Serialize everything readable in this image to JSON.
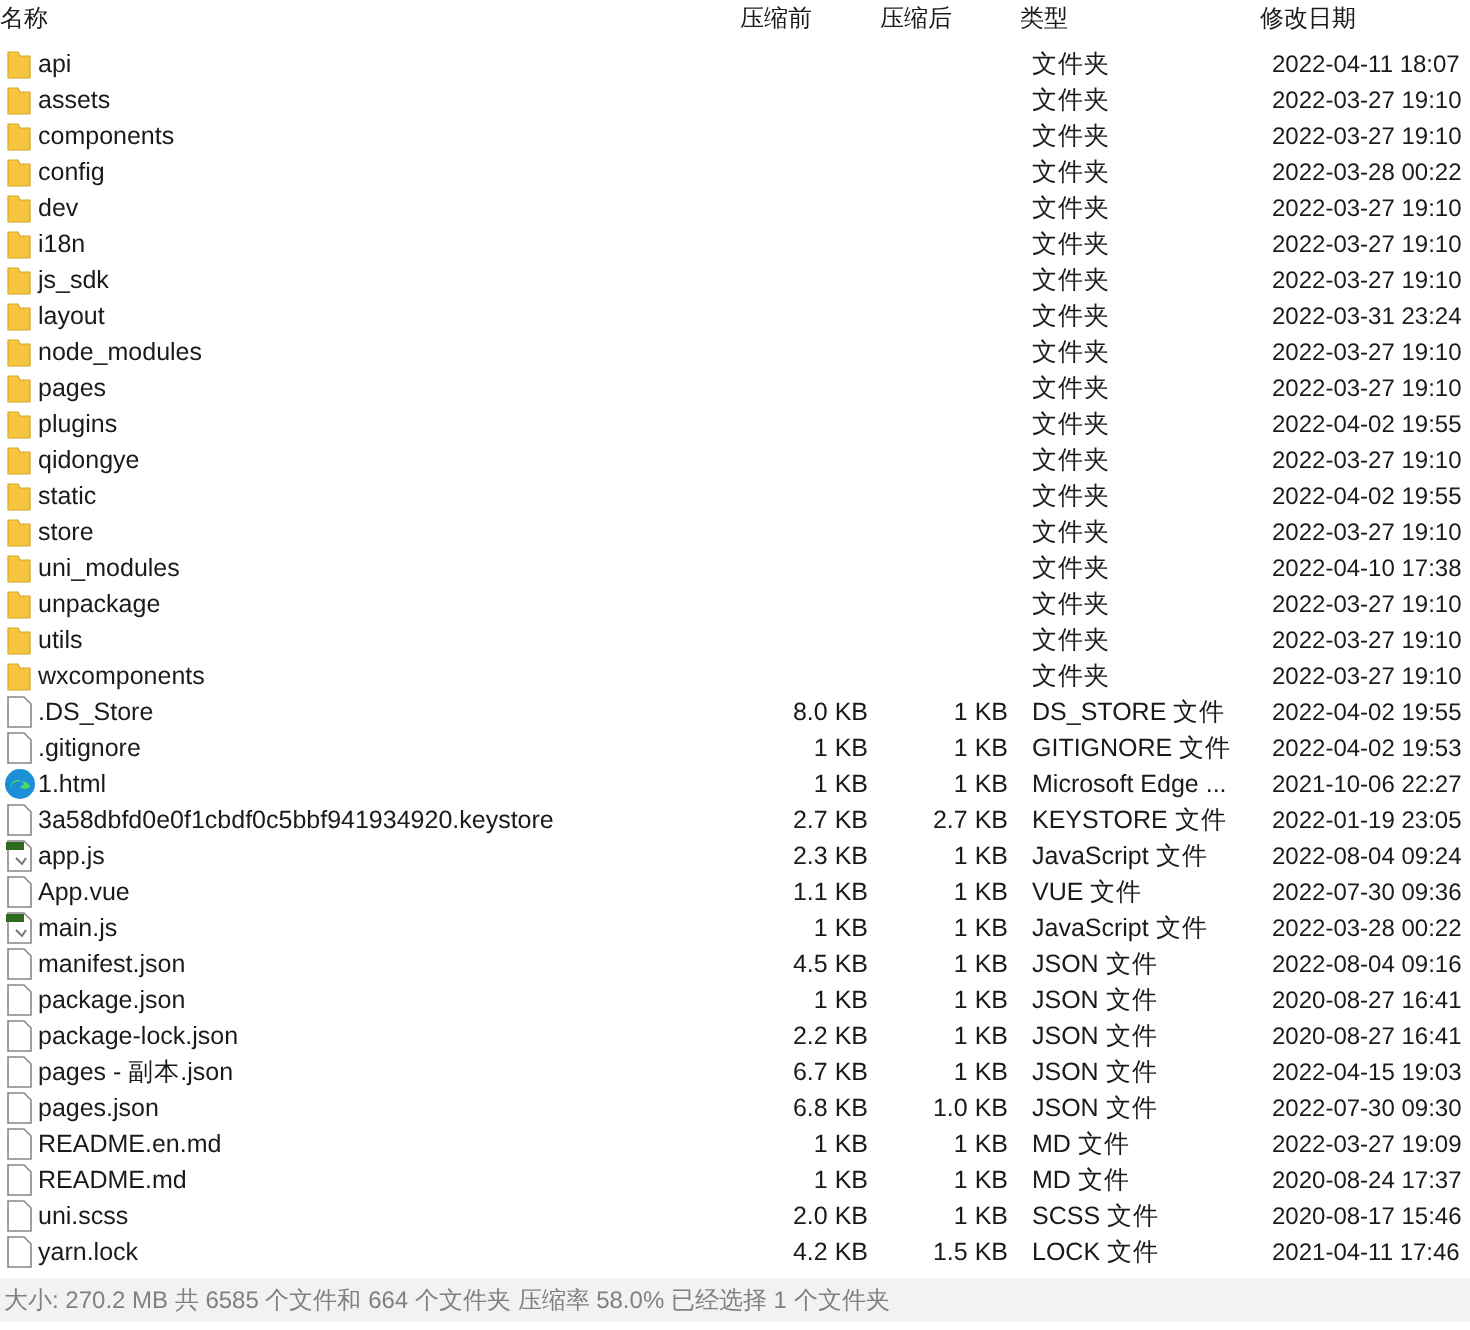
{
  "columns": [
    "名称",
    "压缩前",
    "压缩后",
    "类型",
    "修改日期"
  ],
  "rows": [
    {
      "kind": "folder",
      "name": "api",
      "type": "文件夹",
      "modified": "2022-04-11 18:07"
    },
    {
      "kind": "folder",
      "name": "assets",
      "type": "文件夹",
      "modified": "2022-03-27 19:10"
    },
    {
      "kind": "folder",
      "name": "components",
      "type": "文件夹",
      "modified": "2022-03-27 19:10"
    },
    {
      "kind": "folder",
      "name": "config",
      "type": "文件夹",
      "modified": "2022-03-28 00:22"
    },
    {
      "kind": "folder",
      "name": "dev",
      "type": "文件夹",
      "modified": "2022-03-27 19:10"
    },
    {
      "kind": "folder",
      "name": "i18n",
      "type": "文件夹",
      "modified": "2022-03-27 19:10"
    },
    {
      "kind": "folder",
      "name": "js_sdk",
      "type": "文件夹",
      "modified": "2022-03-27 19:10"
    },
    {
      "kind": "folder",
      "name": "layout",
      "type": "文件夹",
      "modified": "2022-03-31 23:24"
    },
    {
      "kind": "folder",
      "name": "node_modules",
      "type": "文件夹",
      "modified": "2022-03-27 19:10"
    },
    {
      "kind": "folder",
      "name": "pages",
      "type": "文件夹",
      "modified": "2022-03-27 19:10"
    },
    {
      "kind": "folder",
      "name": "plugins",
      "type": "文件夹",
      "modified": "2022-04-02 19:55"
    },
    {
      "kind": "folder",
      "name": "qidongye",
      "type": "文件夹",
      "modified": "2022-03-27 19:10"
    },
    {
      "kind": "folder",
      "name": "static",
      "type": "文件夹",
      "modified": "2022-04-02 19:55"
    },
    {
      "kind": "folder",
      "name": "store",
      "type": "文件夹",
      "modified": "2022-03-27 19:10"
    },
    {
      "kind": "folder",
      "name": "uni_modules",
      "type": "文件夹",
      "modified": "2022-04-10 17:38"
    },
    {
      "kind": "folder",
      "name": "unpackage",
      "type": "文件夹",
      "modified": "2022-03-27 19:10"
    },
    {
      "kind": "folder",
      "name": "utils",
      "type": "文件夹",
      "modified": "2022-03-27 19:10"
    },
    {
      "kind": "folder",
      "name": "wxcomponents",
      "type": "文件夹",
      "modified": "2022-03-27 19:10"
    },
    {
      "kind": "file",
      "name": ".DS_Store",
      "size": "8.0 KB",
      "packed": "1 KB",
      "type": "DS_STORE 文件",
      "modified": "2022-04-02 19:55"
    },
    {
      "kind": "file",
      "name": ".gitignore",
      "size": "1 KB",
      "packed": "1 KB",
      "type": "GITIGNORE 文件",
      "modified": "2022-04-02 19:53"
    },
    {
      "kind": "browser",
      "name": "1.html",
      "size": "1 KB",
      "packed": "1 KB",
      "type": "Microsoft Edge ...",
      "modified": "2021-10-06 22:27"
    },
    {
      "kind": "file",
      "name": "3a58dbfd0e0f1cbdf0c5bbf941934920.keystore",
      "size": "2.7 KB",
      "packed": "2.7 KB",
      "type": "KEYSTORE 文件",
      "modified": "2022-01-19 23:05"
    },
    {
      "kind": "script",
      "name": "app.js",
      "size": "2.3 KB",
      "packed": "1 KB",
      "type": "JavaScript 文件",
      "modified": "2022-08-04 09:24"
    },
    {
      "kind": "file",
      "name": "App.vue",
      "size": "1.1 KB",
      "packed": "1 KB",
      "type": "VUE 文件",
      "modified": "2022-07-30 09:36"
    },
    {
      "kind": "script",
      "name": "main.js",
      "size": "1 KB",
      "packed": "1 KB",
      "type": "JavaScript 文件",
      "modified": "2022-03-28 00:22"
    },
    {
      "kind": "file",
      "name": "manifest.json",
      "size": "4.5 KB",
      "packed": "1 KB",
      "type": "JSON 文件",
      "modified": "2022-08-04 09:16"
    },
    {
      "kind": "file",
      "name": "package.json",
      "size": "1 KB",
      "packed": "1 KB",
      "type": "JSON 文件",
      "modified": "2020-08-27 16:41"
    },
    {
      "kind": "file",
      "name": "package-lock.json",
      "size": "2.2 KB",
      "packed": "1 KB",
      "type": "JSON 文件",
      "modified": "2020-08-27 16:41"
    },
    {
      "kind": "file",
      "name": "pages - 副本.json",
      "size": "6.7 KB",
      "packed": "1 KB",
      "type": "JSON 文件",
      "modified": "2022-04-15 19:03"
    },
    {
      "kind": "file",
      "name": "pages.json",
      "size": "6.8 KB",
      "packed": "1.0 KB",
      "type": "JSON 文件",
      "modified": "2022-07-30 09:30"
    },
    {
      "kind": "file",
      "name": "README.en.md",
      "size": "1 KB",
      "packed": "1 KB",
      "type": "MD 文件",
      "modified": "2022-03-27 19:09"
    },
    {
      "kind": "file",
      "name": "README.md",
      "size": "1 KB",
      "packed": "1 KB",
      "type": "MD 文件",
      "modified": "2020-08-24 17:37"
    },
    {
      "kind": "file",
      "name": "uni.scss",
      "size": "2.0 KB",
      "packed": "1 KB",
      "type": "SCSS 文件",
      "modified": "2020-08-17 15:46"
    },
    {
      "kind": "file",
      "name": "yarn.lock",
      "size": "4.2 KB",
      "packed": "1.5 KB",
      "type": "LOCK 文件",
      "modified": "2021-04-11 17:46"
    }
  ],
  "status_bar": "大小: 270.2 MB 共 6585 个文件和 664 个文件夹 压缩率 58.0% 已经选择 1 个文件夹"
}
